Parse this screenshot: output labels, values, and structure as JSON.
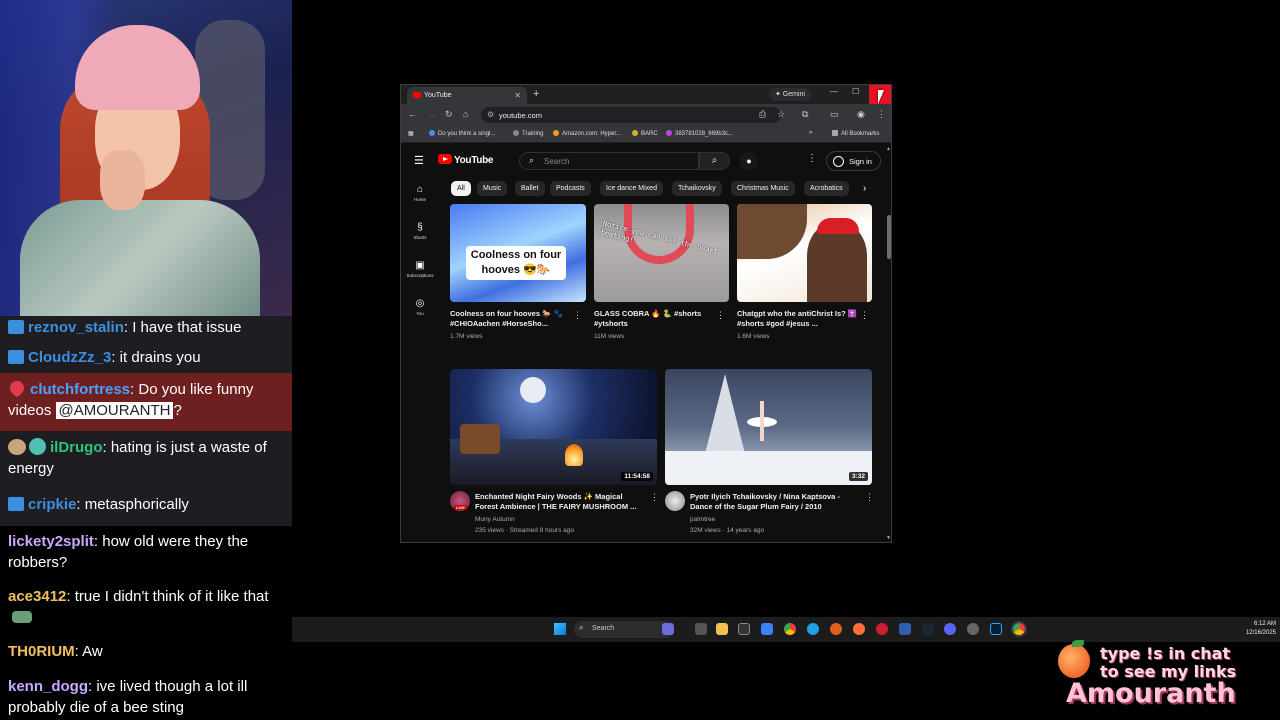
{
  "chat": {
    "messages": [
      {
        "user": "reznov_stalin",
        "text": ": I have that issue",
        "color": "#3b8fe0"
      },
      {
        "user": "CloudzZz_3",
        "text": ": it drains you",
        "color": "#3b8fe0"
      },
      {
        "user": "clutchfortress",
        "text": ": Do you like funny videos ",
        "mention": "@AMOURANTH",
        "tail": "?",
        "color": "#4aa3ff"
      },
      {
        "user": "ilDrugo",
        "text": ": hating is just a waste of energy",
        "color": "#2ec47a"
      },
      {
        "user": "cripkie",
        "text": ": metasphorically",
        "color": "#3b8fe0"
      },
      {
        "user": "lickety2split",
        "text": ": how old were they the robbers?",
        "color": "#c9a8ff"
      },
      {
        "user": "ace3412",
        "text": ": true I didn't think of it like that",
        "color": "#f0c060"
      },
      {
        "user": "TH0RIUM",
        "text": ": Aw",
        "color": "#f0c060"
      },
      {
        "user": "kenn_dogg",
        "text": ": ive lived though a lot ill probably die of a bee sting",
        "color": "#c9a8ff"
      }
    ]
  },
  "browser": {
    "tab_title": "YouTube",
    "tab_close": "✕",
    "new_tab": "+",
    "gemini": "✦ Gemini",
    "minimize": "—",
    "maximize": "☐",
    "close": "✕",
    "url": "youtube.com",
    "bookmarks": [
      "Do you think a singl...",
      "Training",
      "Amazon.com: Hyper...",
      "BARC",
      "383781028_669b3c..."
    ],
    "all_bookmarks": "All Bookmarks",
    "bookmarks_more": "»"
  },
  "youtube": {
    "logo": "YouTube",
    "search_placeholder": "Search",
    "sign_in": "Sign in",
    "sidebar": [
      "Home",
      "Shorts",
      "Subscriptions",
      "You"
    ],
    "chips": [
      "All",
      "Music",
      "Ballet",
      "Podcasts",
      "Ice dance Mixed",
      "Tchaikovsky",
      "Christmas Music",
      "Acrobatics"
    ],
    "shorts": [
      {
        "title": "Coolness on four hooves 🐎 🐾 #CHIOAachen #HorseSho...",
        "views": "1.7M views",
        "overlay": "Coolness on four hooves 😎🐎",
        "thumb_text": ""
      },
      {
        "title": "GLASS COBRA 🔥 🐍 #shorts #ytshorts",
        "views": "11M views",
        "overlay": "",
        "thumb_text": "Notice you can see the heart beating!"
      },
      {
        "title": "Chatgpt who the antiChrist Is? ✝️ #shorts #god #jesus ...",
        "views": "1.6M views",
        "overlay": "",
        "thumb_text": ""
      }
    ],
    "videos": [
      {
        "title": "Enchanted Night Fairy Woods ✨ Magical Forest Ambience | THE FAIRY MUSHROOM ...",
        "channel": "Muny Autumn",
        "meta": "235 views · Streamed 8 hours ago",
        "duration": "11:54:58",
        "live": "LIVE"
      },
      {
        "title": "Pyotr Ilyich Tchaikovsky / Nina Kaptsova - Dance of the Sugar Plum Fairy / 2010",
        "channel": "palmtree",
        "meta": "32M views · 14 years ago",
        "duration": "3:32"
      }
    ]
  },
  "taskbar": {
    "search": "Search",
    "time": "6:12 AM",
    "date": "12/16/2025"
  },
  "overlay": {
    "line1": "type !s in chat",
    "line2": "to see my links",
    "brand": "Amouranth"
  }
}
